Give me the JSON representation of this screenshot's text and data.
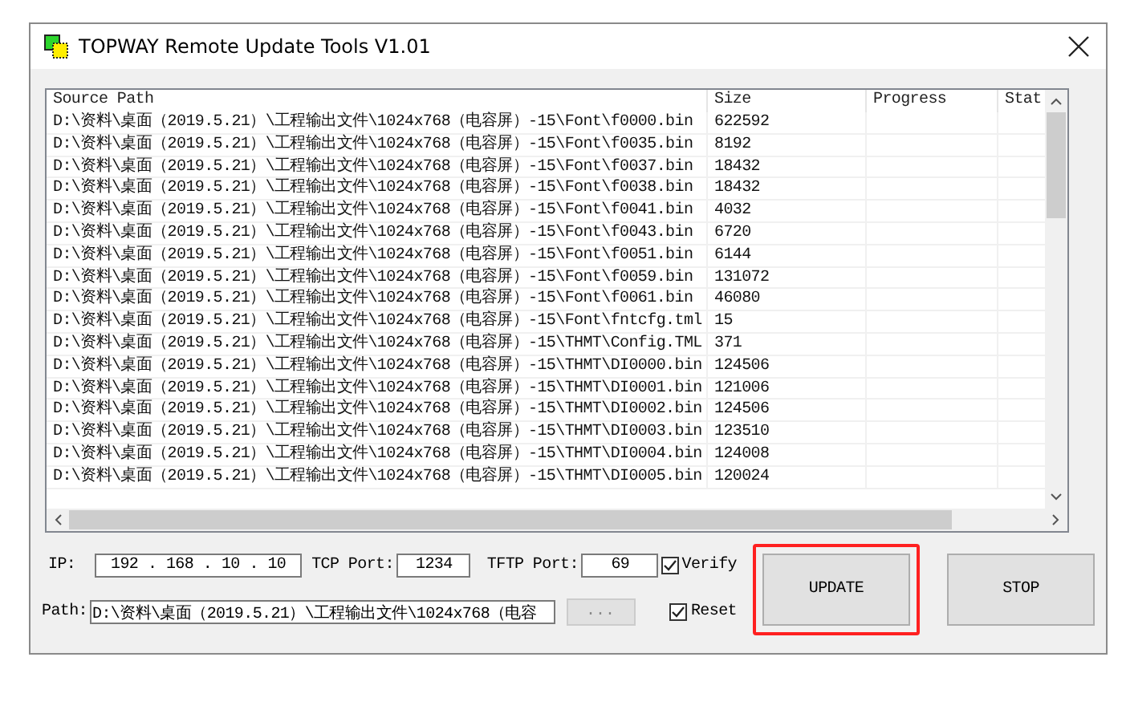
{
  "window": {
    "title": "TOPWAY Remote Update Tools V1.01"
  },
  "table": {
    "columns": [
      "Source Path",
      "Size",
      "Progress",
      "Stat"
    ],
    "rows": [
      {
        "source_path": "D:\\资料\\桌面（2019.5.21）\\工程输出文件\\1024x768（电容屏）-15\\Font\\f0000.bin",
        "size": "622592"
      },
      {
        "source_path": "D:\\资料\\桌面（2019.5.21）\\工程输出文件\\1024x768（电容屏）-15\\Font\\f0035.bin",
        "size": "8192"
      },
      {
        "source_path": "D:\\资料\\桌面（2019.5.21）\\工程输出文件\\1024x768（电容屏）-15\\Font\\f0037.bin",
        "size": "18432"
      },
      {
        "source_path": "D:\\资料\\桌面（2019.5.21）\\工程输出文件\\1024x768（电容屏）-15\\Font\\f0038.bin",
        "size": "18432"
      },
      {
        "source_path": "D:\\资料\\桌面（2019.5.21）\\工程输出文件\\1024x768（电容屏）-15\\Font\\f0041.bin",
        "size": "4032"
      },
      {
        "source_path": "D:\\资料\\桌面（2019.5.21）\\工程输出文件\\1024x768（电容屏）-15\\Font\\f0043.bin",
        "size": "6720"
      },
      {
        "source_path": "D:\\资料\\桌面（2019.5.21）\\工程输出文件\\1024x768（电容屏）-15\\Font\\f0051.bin",
        "size": "6144"
      },
      {
        "source_path": "D:\\资料\\桌面（2019.5.21）\\工程输出文件\\1024x768（电容屏）-15\\Font\\f0059.bin",
        "size": "131072"
      },
      {
        "source_path": "D:\\资料\\桌面（2019.5.21）\\工程输出文件\\1024x768（电容屏）-15\\Font\\f0061.bin",
        "size": "46080"
      },
      {
        "source_path": "D:\\资料\\桌面（2019.5.21）\\工程输出文件\\1024x768（电容屏）-15\\Font\\fntcfg.tml",
        "size": "15"
      },
      {
        "source_path": "D:\\资料\\桌面（2019.5.21）\\工程输出文件\\1024x768（电容屏）-15\\THMT\\Config.TML",
        "size": "371"
      },
      {
        "source_path": "D:\\资料\\桌面（2019.5.21）\\工程输出文件\\1024x768（电容屏）-15\\THMT\\DI0000.bin",
        "size": "124506"
      },
      {
        "source_path": "D:\\资料\\桌面（2019.5.21）\\工程输出文件\\1024x768（电容屏）-15\\THMT\\DI0001.bin",
        "size": "121006"
      },
      {
        "source_path": "D:\\资料\\桌面（2019.5.21）\\工程输出文件\\1024x768（电容屏）-15\\THMT\\DI0002.bin",
        "size": "124506"
      },
      {
        "source_path": "D:\\资料\\桌面（2019.5.21）\\工程输出文件\\1024x768（电容屏）-15\\THMT\\DI0003.bin",
        "size": "123510"
      },
      {
        "source_path": "D:\\资料\\桌面（2019.5.21）\\工程输出文件\\1024x768（电容屏）-15\\THMT\\DI0004.bin",
        "size": "124008"
      },
      {
        "source_path": "D:\\资料\\桌面（2019.5.21）\\工程输出文件\\1024x768（电容屏）-15\\THMT\\DI0005.bin",
        "size": "120024"
      }
    ]
  },
  "settings": {
    "ip_label": "IP:",
    "ip": [
      "192",
      ".",
      "168",
      ".",
      "10",
      ".",
      "10"
    ],
    "tcp_label": "TCP Port:",
    "tcp_port": "1234",
    "tftp_label": "TFTP Port:",
    "tftp_port": "69",
    "verify": {
      "label": "Verify",
      "checked": true
    },
    "path_label": "Path:",
    "path": "D:\\资料\\桌面（2019.5.21）\\工程输出文件\\1024x768（电容",
    "browse": "...",
    "reset": {
      "label": "Reset",
      "checked": true
    }
  },
  "buttons": [
    {
      "label": "UPDATE",
      "highlighted": true
    },
    {
      "label": "STOP",
      "highlighted": false
    }
  ]
}
